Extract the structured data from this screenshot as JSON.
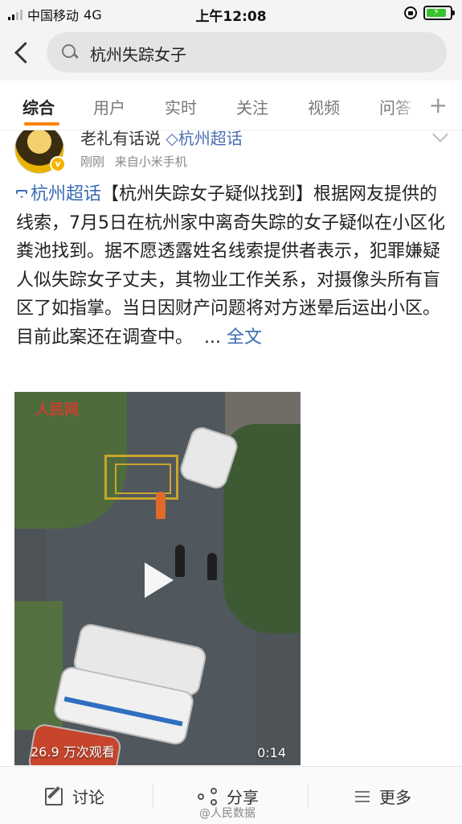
{
  "status_bar": {
    "carrier": "中国移动",
    "network": "4G",
    "time": "上午12:08",
    "battery_level": 0.85,
    "battery_color": "#35c22d"
  },
  "search": {
    "query": "杭州失踪女子"
  },
  "tabs": [
    {
      "label": "综合",
      "active": true
    },
    {
      "label": "用户"
    },
    {
      "label": "实时"
    },
    {
      "label": "关注"
    },
    {
      "label": "视频"
    },
    {
      "label": "问答"
    }
  ],
  "tab_accent": "#ff8200",
  "post": {
    "author": "老礼有话说",
    "author_topic": "杭州超话",
    "time": "刚刚",
    "source": "来自小米手机",
    "topic": "杭州超话",
    "body": "【杭州失踪女子疑似找到】根据网友提供的线索，7月5日在杭州家中离奇失踪的女子疑似在小区化粪池找到。据不愿透露姓名线索提供者表示，犯罪嫌疑人似失踪女子丈夫，其物业工作关系，对摄像头所有盲区了如指掌。当日因财产问题将对方迷晕后运出小区。目前此案还在调查中。",
    "ellipsis": "...",
    "full_text_link": "全文"
  },
  "video": {
    "source_logo": "人民网",
    "views": "26.9 万次观看",
    "duration": "0:14"
  },
  "bottom_bar": {
    "discuss": "讨论",
    "share": "分享",
    "more": "更多",
    "watermark": "@人民数据"
  }
}
